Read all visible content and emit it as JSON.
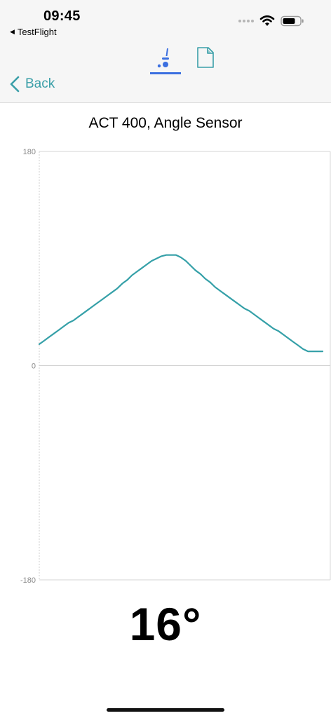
{
  "status_bar": {
    "time": "09:45",
    "return_app": "TestFlight"
  },
  "nav": {
    "back_label": "Back",
    "tabs": [
      {
        "icon": "sensor-icon",
        "active": true
      },
      {
        "icon": "document-icon",
        "active": false
      }
    ]
  },
  "colors": {
    "accent": "#3a9fa8",
    "tab_active": "#3b6fe0",
    "line": "#35a0a8"
  },
  "chart_data": {
    "type": "line",
    "title": "ACT 400, Angle Sensor",
    "xlabel": "",
    "ylabel": "",
    "ylim": [
      -180,
      180
    ],
    "yticks": [
      "180",
      "0",
      "-180"
    ],
    "grid": false,
    "series": [
      {
        "values": [
          18,
          21,
          24,
          27,
          30,
          33,
          36,
          38,
          41,
          44,
          47,
          50,
          53,
          56,
          59,
          62,
          65,
          69,
          72,
          76,
          79,
          82,
          85,
          88,
          90,
          92,
          93,
          93,
          93,
          91,
          88,
          84,
          80,
          77,
          73,
          70,
          66,
          63,
          60,
          57,
          54,
          51,
          48,
          46,
          43,
          40,
          37,
          34,
          31,
          29,
          26,
          23,
          20,
          17,
          14,
          12,
          12,
          12,
          12
        ]
      }
    ]
  },
  "reading": {
    "value": "16°"
  }
}
